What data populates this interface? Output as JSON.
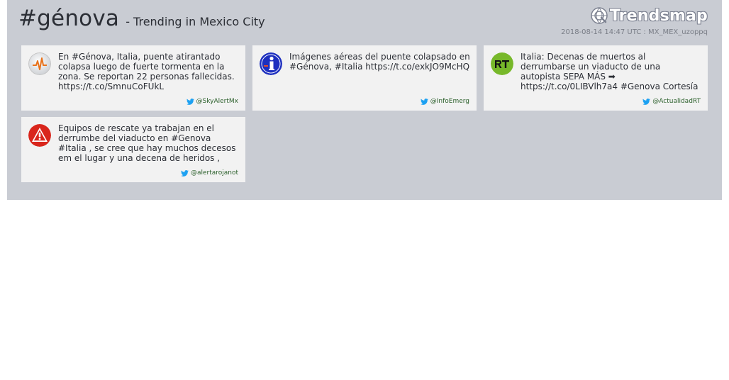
{
  "header": {
    "hashtag": "#génova",
    "subtitle": "- Trending in Mexico City",
    "brand": "Trendsmap",
    "meta": "2018-08-14 14:47 UTC : MX_MEX_uzoppq"
  },
  "cards": [
    {
      "text": "En #Génova, Italia, puente atirantado colapsa luego de fuerte tormenta en la zona. Se reportan 22 personas fallecidas. https://t.co/SmnuCoFUkL",
      "handle": "@SkyAlertMx",
      "avatar_icon": "skyalert-logo-icon"
    },
    {
      "text": "Imágenes aéreas del puente colapsado en #Génova, #Italia https://t.co/exkJO9McHQ",
      "handle": "@InfoEmerg",
      "avatar_icon": "info-logo-icon"
    },
    {
      "text": "Italia: Decenas de muertos al derrumbarse un viaducto de una autopista SEPA MÁS ➡ https://t.co/0LIBVlh7a4 #Genova Cortesía",
      "handle": "@ActualidadRT",
      "avatar_icon": "rt-logo-icon"
    },
    {
      "text": "Equipos de rescate ya trabajan en el derrumbe del viaducto en #Genova #Italia , se cree que hay muchos decesos em el lugar y una decena de heridos ,",
      "handle": "@alertarojanot",
      "avatar_icon": "warning-logo-icon"
    }
  ],
  "colors": {
    "panel": "#c9ccd3",
    "card": "#f2f2f2",
    "twitter": "#1da1f2",
    "rt_green": "#77b82a",
    "info_blue": "#1d2fbf",
    "alert_red": "#d9261c"
  }
}
